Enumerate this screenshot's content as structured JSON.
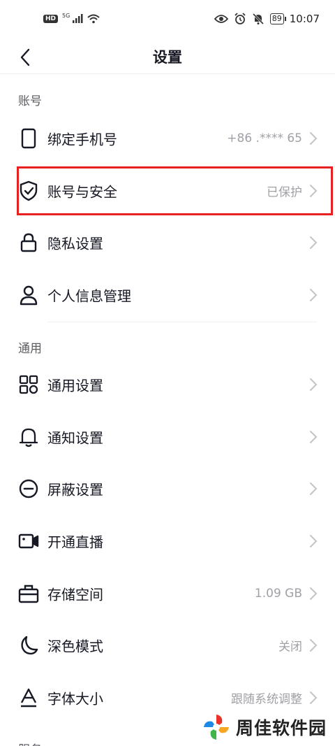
{
  "status_bar": {
    "hd": "HD",
    "network": "5G",
    "battery": "89",
    "time": "10:07"
  },
  "nav": {
    "title": "设置"
  },
  "sections": [
    {
      "header": "账号",
      "items": [
        {
          "label": "绑定手机号",
          "value": "+86  .****  65",
          "icon": "phone-icon"
        },
        {
          "label": "账号与安全",
          "value": "已保护",
          "icon": "shield-check-icon"
        },
        {
          "label": "隐私设置",
          "value": "",
          "icon": "lock-icon"
        },
        {
          "label": "个人信息管理",
          "value": "",
          "icon": "person-icon"
        }
      ]
    },
    {
      "header": "通用",
      "items": [
        {
          "label": "通用设置",
          "value": "",
          "icon": "grid-icon"
        },
        {
          "label": "通知设置",
          "value": "",
          "icon": "bell-icon"
        },
        {
          "label": "屏蔽设置",
          "value": "",
          "icon": "block-icon"
        },
        {
          "label": "开通直播",
          "value": "",
          "icon": "video-camera-icon"
        },
        {
          "label": "存储空间",
          "value": "1.09 GB",
          "icon": "storage-icon"
        },
        {
          "label": "深色模式",
          "value": "关闭",
          "icon": "moon-icon"
        },
        {
          "label": "字体大小",
          "value": "跟随系统调整",
          "icon": "font-icon"
        }
      ]
    }
  ],
  "partial_header": "服务",
  "watermark": {
    "text": "周佳软件园",
    "colors": [
      "#e8332b",
      "#f5a623",
      "#3fb54a",
      "#1e88e5"
    ]
  },
  "highlight_color": "#e82020"
}
